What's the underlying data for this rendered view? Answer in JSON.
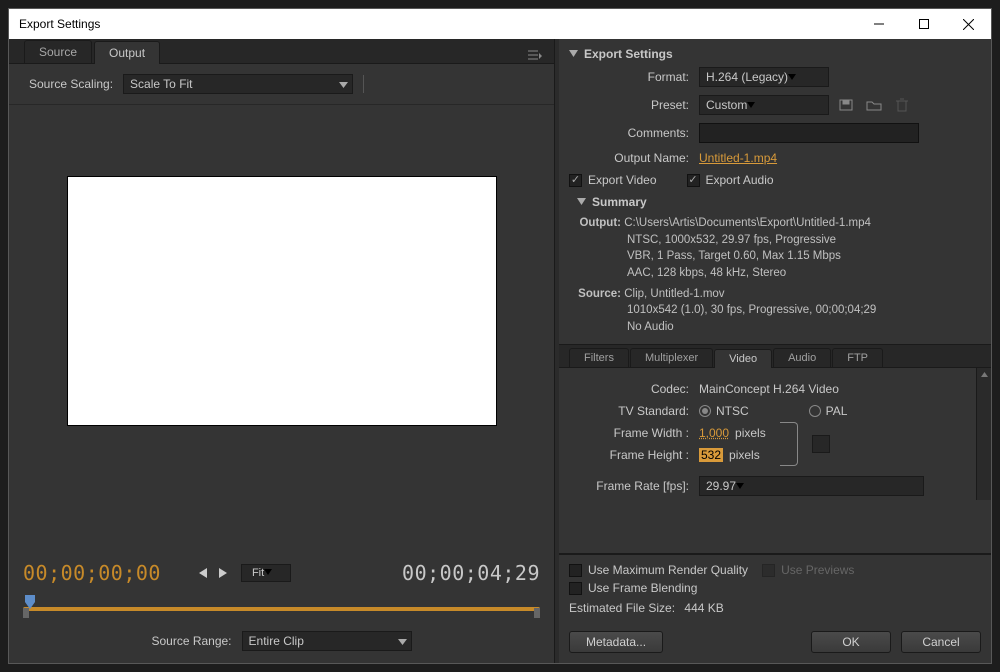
{
  "window": {
    "title": "Export Settings"
  },
  "left": {
    "tabs": {
      "source": "Source",
      "output": "Output"
    },
    "scaling_label": "Source Scaling:",
    "scaling_value": "Scale To Fit",
    "tc_current": "00;00;00;00",
    "fit_label": "Fit",
    "tc_total": "00;00;04;29",
    "range_label": "Source Range:",
    "range_value": "Entire Clip"
  },
  "right": {
    "header": "Export Settings",
    "format_label": "Format:",
    "format_value": "H.264 (Legacy)",
    "preset_label": "Preset:",
    "preset_value": "Custom",
    "comments_label": "Comments:",
    "output_name_label": "Output Name:",
    "output_name_value": "Untitled-1.mp4",
    "export_video": "Export Video",
    "export_audio": "Export Audio",
    "summary_header": "Summary",
    "summary": {
      "output_label": "Output:",
      "output_l1": "C:\\Users\\Artis\\Documents\\Export\\Untitled-1.mp4",
      "output_l2": "NTSC, 1000x532, 29.97 fps, Progressive",
      "output_l3": "VBR, 1 Pass, Target 0.60, Max 1.15 Mbps",
      "output_l4": "AAC, 128 kbps, 48 kHz, Stereo",
      "source_label": "Source:",
      "source_l1": "Clip, Untitled-1.mov",
      "source_l2": "1010x542 (1.0), 30 fps, Progressive, 00;00;04;29",
      "source_l3": "No Audio"
    },
    "tabs": {
      "filters": "Filters",
      "multiplexer": "Multiplexer",
      "video": "Video",
      "audio": "Audio",
      "ftp": "FTP"
    },
    "video": {
      "codec_label": "Codec:",
      "codec_value": "MainConcept H.264 Video",
      "tv_label": "TV Standard:",
      "tv_ntsc": "NTSC",
      "tv_pal": "PAL",
      "fw_label": "Frame Width :",
      "fw_value": "1,000",
      "fh_label": "Frame Height :",
      "fh_value": "532",
      "pixels": "pixels",
      "fr_label": "Frame Rate [fps]:",
      "fr_value": "29.97"
    },
    "bottom": {
      "use_max": "Use Maximum Render Quality",
      "use_prev": "Use Previews",
      "use_blend": "Use Frame Blending",
      "est_label": "Estimated File Size:",
      "est_value": "444 KB",
      "metadata": "Metadata...",
      "ok": "OK",
      "cancel": "Cancel"
    }
  }
}
